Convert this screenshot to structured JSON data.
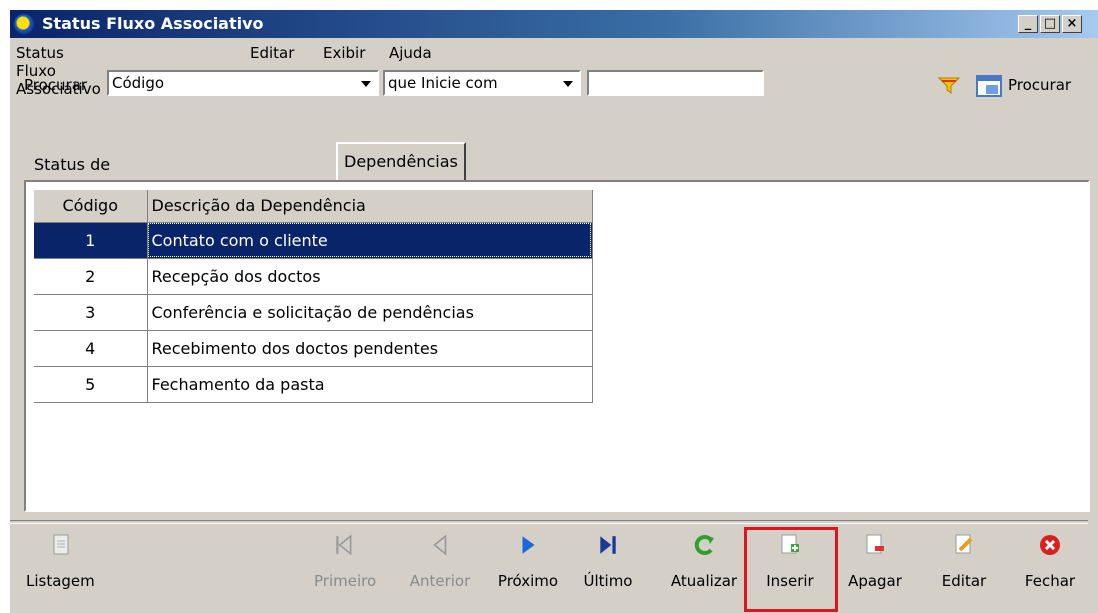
{
  "window": {
    "title": "Status Fluxo Associativo"
  },
  "menu": {
    "items": [
      "Status Fluxo Associativo",
      "Editar",
      "Exibir",
      "Ajuda"
    ]
  },
  "search": {
    "label": "Procurar",
    "field_value": "Código",
    "mode_value": "que Inicie com",
    "text_value": "",
    "search_button": "Procurar"
  },
  "tabs": [
    "Status de Fluxos Associativos",
    "Dependências"
  ],
  "active_tab": "Dependências",
  "grid": {
    "columns": [
      "Código",
      "Descrição da Dependência"
    ],
    "rows": [
      {
        "codigo": "1",
        "descricao": "Contato com o cliente"
      },
      {
        "codigo": "2",
        "descricao": "Recepção dos doctos"
      },
      {
        "codigo": "3",
        "descricao": "Conferência e solicitação de pendências"
      },
      {
        "codigo": "4",
        "descricao": "Recebimento dos doctos pendentes"
      },
      {
        "codigo": "5",
        "descricao": "Fechamento da pasta"
      }
    ],
    "selected_row": 1
  },
  "toolbar": {
    "listagem": "Listagem",
    "primeiro": "Primeiro",
    "anterior": "Anterior",
    "proximo": "Próximo",
    "ultimo": "Último",
    "atualizar": "Atualizar",
    "inserir": "Inserir",
    "apagar": "Apagar",
    "editar": "Editar",
    "fechar": "Fechar"
  },
  "colors": {
    "selection": "#0a246a",
    "highlight_box": "#e0141e",
    "window_bg": "#d4d0c8"
  }
}
